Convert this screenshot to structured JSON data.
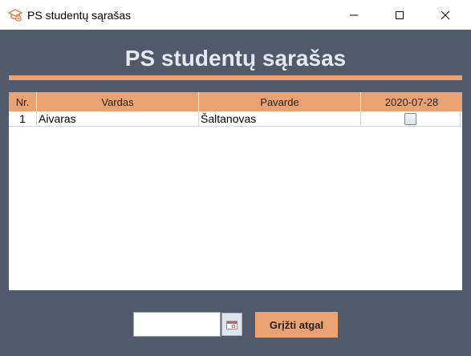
{
  "window": {
    "title": "PS studentų sąrašas",
    "icon": "graduation-cap-icon",
    "controls": [
      "minimize-icon",
      "maximize-icon",
      "close-icon"
    ]
  },
  "header": {
    "title": "PS studentų sąrašas"
  },
  "table": {
    "columns": [
      "Nr.",
      "Vardas",
      "Pavarde",
      "2020-07-28"
    ],
    "rows": [
      {
        "nr": "1",
        "vardas": "Aivaras",
        "pavarde": "Šaltanovas",
        "present": false
      }
    ]
  },
  "controls": {
    "date_value": "",
    "calendar_icon": "calendar-icon",
    "back_label": "Grįžti atgal"
  },
  "colors": {
    "background": "#505a6b",
    "accent": "#eba273",
    "title_text": "#e6e8ee"
  }
}
